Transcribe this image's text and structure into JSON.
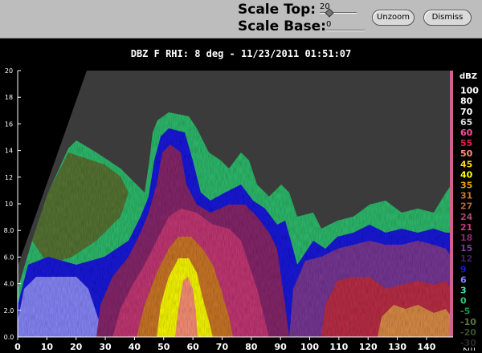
{
  "controls": {
    "scale_top_label": "Scale Top:",
    "scale_top_value": "20",
    "scale_base_label": "Scale Base:",
    "scale_base_value": "0",
    "unzoom_label": "Unzoom",
    "dismiss_label": "Dismiss"
  },
  "plot": {
    "title": "DBZ F  RHI: 8 deg  -  11/23/2011 01:51:07",
    "x_unit": "km",
    "x_ticks": [
      "0",
      "10",
      "20",
      "30",
      "40",
      "50",
      "60",
      "70",
      "80",
      "90",
      "100",
      "110",
      "120",
      "130",
      "140"
    ],
    "y_ticks": [
      "0.0",
      "2.0",
      "4.0",
      "6.0",
      "8.0",
      "10",
      "12",
      "14",
      "16",
      "18",
      "20"
    ]
  },
  "legend": {
    "unit": "dBZ",
    "levels": [
      {
        "label": "100",
        "color": "#ffffff"
      },
      {
        "label": "80",
        "color": "#ffffff"
      },
      {
        "label": "70",
        "color": "#ffffff"
      },
      {
        "label": "65",
        "color": "#d8d8d8"
      },
      {
        "label": "60",
        "color": "#ff50a0"
      },
      {
        "label": "55",
        "color": "#e0204a"
      },
      {
        "label": "50",
        "color": "#ff9478"
      },
      {
        "label": "45",
        "color": "#ffd700"
      },
      {
        "label": "40",
        "color": "#ffff00"
      },
      {
        "label": "35",
        "color": "#f0a000"
      },
      {
        "label": "31",
        "color": "#c87a2a"
      },
      {
        "label": "27",
        "color": "#b06838"
      },
      {
        "label": "24",
        "color": "#a8486a"
      },
      {
        "label": "21",
        "color": "#c83a78"
      },
      {
        "label": "18",
        "color": "#8a2a6e"
      },
      {
        "label": "15",
        "color": "#7a3a9a"
      },
      {
        "label": "12",
        "color": "#40206a"
      },
      {
        "label": "9",
        "color": "#1818e0"
      },
      {
        "label": "6",
        "color": "#8888ff"
      },
      {
        "label": "3",
        "color": "#50e0b0"
      },
      {
        "label": "0",
        "color": "#30c878"
      },
      {
        "label": "-5",
        "color": "#209050"
      },
      {
        "label": "-10",
        "color": "#5a7838"
      },
      {
        "label": "-20",
        "color": "#3a5020"
      },
      {
        "label": "-30",
        "color": "#2a2a2a"
      }
    ]
  }
}
